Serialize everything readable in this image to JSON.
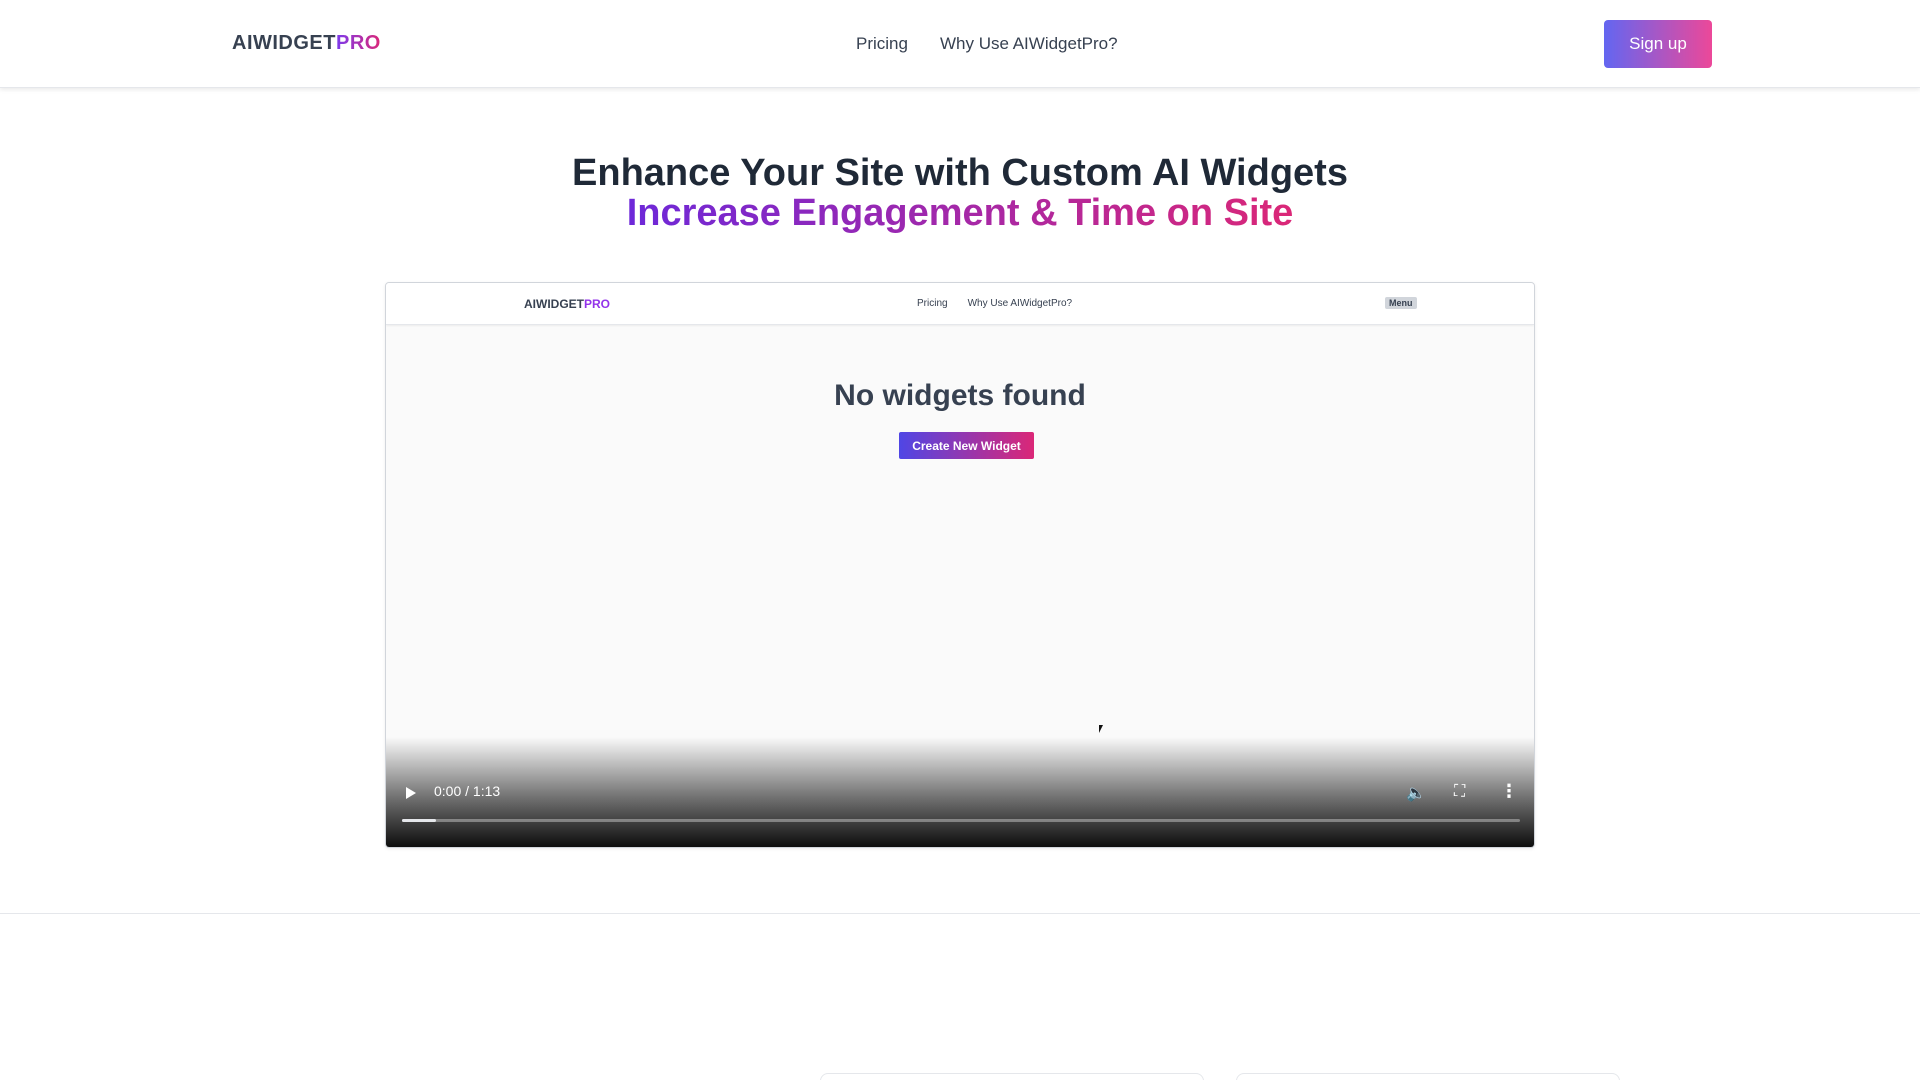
{
  "header": {
    "logo_main": "AIWIDGET",
    "logo_accent": "PRO",
    "nav": [
      "Pricing",
      "Why Use AIWidgetPro?"
    ],
    "signup_label": "Sign up"
  },
  "hero": {
    "title": "Enhance Your Site with Custom AI Widgets",
    "subtitle": "Increase Engagement & Time on Site"
  },
  "video": {
    "inner_logo_main": "AIWIDGET",
    "inner_logo_accent": "PRO",
    "inner_nav": [
      "Pricing",
      "Why Use AIWidgetPro?"
    ],
    "inner_menu": "Menu",
    "empty_message": "No widgets found",
    "create_button": "Create New Widget",
    "time": "0:00 / 1:13",
    "buffered_fraction": 0.03
  },
  "colors": {
    "accent_start": "#6366f1",
    "accent_end": "#ec4899"
  }
}
